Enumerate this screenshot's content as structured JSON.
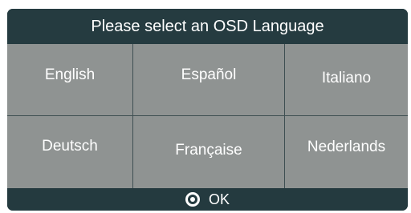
{
  "dialog": {
    "title": "Please select an OSD Language",
    "languages": [
      [
        "English",
        "Español",
        "Italiano"
      ],
      [
        "Deutsch",
        "Française",
        "Nederlands"
      ]
    ],
    "confirm_label": "OK",
    "confirm_icon": "ok-button-icon"
  },
  "colors": {
    "dialog_bg": "#243a3f",
    "grid_bg": "#8f9392",
    "grid_lines": "#3f4f52",
    "text": "#ffffff"
  }
}
